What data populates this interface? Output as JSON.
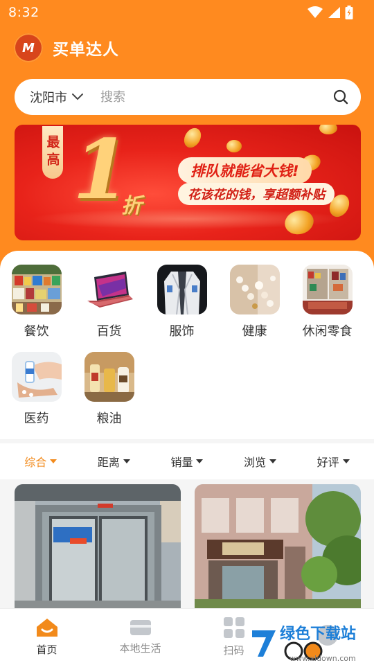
{
  "status_bar": {
    "time": "8:32"
  },
  "header": {
    "logo_text": "M",
    "title": "买单达人"
  },
  "search": {
    "city": "沈阳市",
    "placeholder": "搜索"
  },
  "banner": {
    "tag": "最高",
    "number": "1",
    "unit": "折",
    "line1": "排队就能省大钱!",
    "line2": "花该花的钱，享超额补贴"
  },
  "categories": [
    {
      "label": "餐饮",
      "icon": "food-shelf-image"
    },
    {
      "label": "百货",
      "icon": "laptop-image"
    },
    {
      "label": "服饰",
      "icon": "jacket-image"
    },
    {
      "label": "健康",
      "icon": "pearls-image"
    },
    {
      "label": "休闲零食",
      "icon": "snack-store-image"
    },
    {
      "label": "医药",
      "icon": "medicine-image"
    },
    {
      "label": "粮油",
      "icon": "grain-oil-image"
    }
  ],
  "sort": [
    {
      "label": "综合",
      "active": true
    },
    {
      "label": "距离",
      "active": false
    },
    {
      "label": "销量",
      "active": false
    },
    {
      "label": "浏览",
      "active": false
    },
    {
      "label": "好评",
      "active": false
    }
  ],
  "bottom_nav": [
    {
      "label": "首页",
      "icon": "home-icon",
      "active": true
    },
    {
      "label": "本地生活",
      "icon": "card-icon",
      "active": false
    },
    {
      "label": "扫码",
      "icon": "grid-icon",
      "active": false
    }
  ],
  "watermark": {
    "text": "绿色下载站",
    "url": "www.xldown.com"
  },
  "colors": {
    "accent": "#ff8a1f",
    "active_text": "#f28a1b",
    "banner_red": "#e8231a"
  }
}
